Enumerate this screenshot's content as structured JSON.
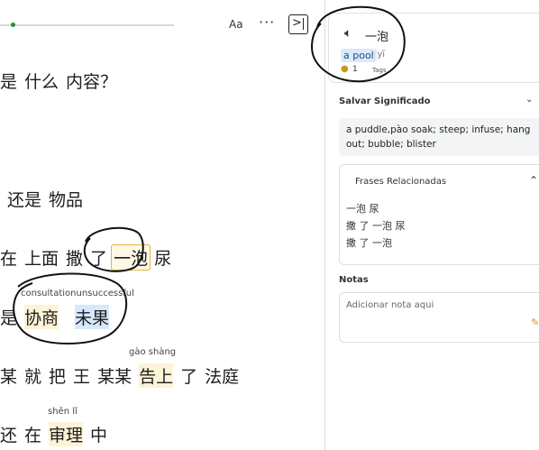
{
  "toolbar": {
    "font_label": "Aa",
    "more_label": "···",
    "panel_toggle_label": ">",
    "progress": 0.07
  },
  "reader": {
    "lines": [
      {
        "words": [
          "是",
          "什么",
          "内容？"
        ]
      },
      {
        "words": [
          "还是",
          "物品"
        ]
      },
      {
        "words": [
          "在",
          "上面",
          "撒",
          "了",
          "一泡",
          "尿"
        ]
      },
      {
        "words": [
          "是",
          "协商",
          "未果"
        ],
        "annotation": "consultationunsuccessful"
      },
      {
        "words": [
          "某",
          "就",
          "把",
          "王",
          "某某",
          "告上",
          "了",
          "法庭"
        ],
        "pinyin": "gào shàng"
      },
      {
        "words": [
          "还",
          "在",
          "审理",
          "中"
        ],
        "pinyin": "shěn  lǐ"
      }
    ]
  },
  "definition": {
    "headword": "一泡",
    "translation": "a pool",
    "pinyin": "· yī",
    "coin_count": "1",
    "tags_label": "Tags",
    "save_meaning_title": "Salvar Significado",
    "meaning_text": "a puddle,pào  soak; steep; infuse; hang out; bubble; blister",
    "related_title": "Frases Relacionadas",
    "related_phrases": [
      "一泡 尿",
      "撒 了 一泡 尿",
      "撒 了 一泡"
    ],
    "notes_title": "Notas",
    "notes_placeholder": "Adicionar nota aqui"
  },
  "colors": {
    "accent_green": "#1f8f3a",
    "highlight_yellow": "#fdf3d6",
    "highlight_blue": "#d6e8fb",
    "selected_border": "#e8b43a",
    "translation_bg": "#dbe9f8"
  },
  "icons": {
    "speaker": "speaker-icon",
    "coin": "coin-icon",
    "chevron_down": "chevron-down-icon",
    "chevron_up": "chevron-up-icon",
    "panel_toggle": "panel-toggle-icon",
    "note": "note-icon"
  }
}
